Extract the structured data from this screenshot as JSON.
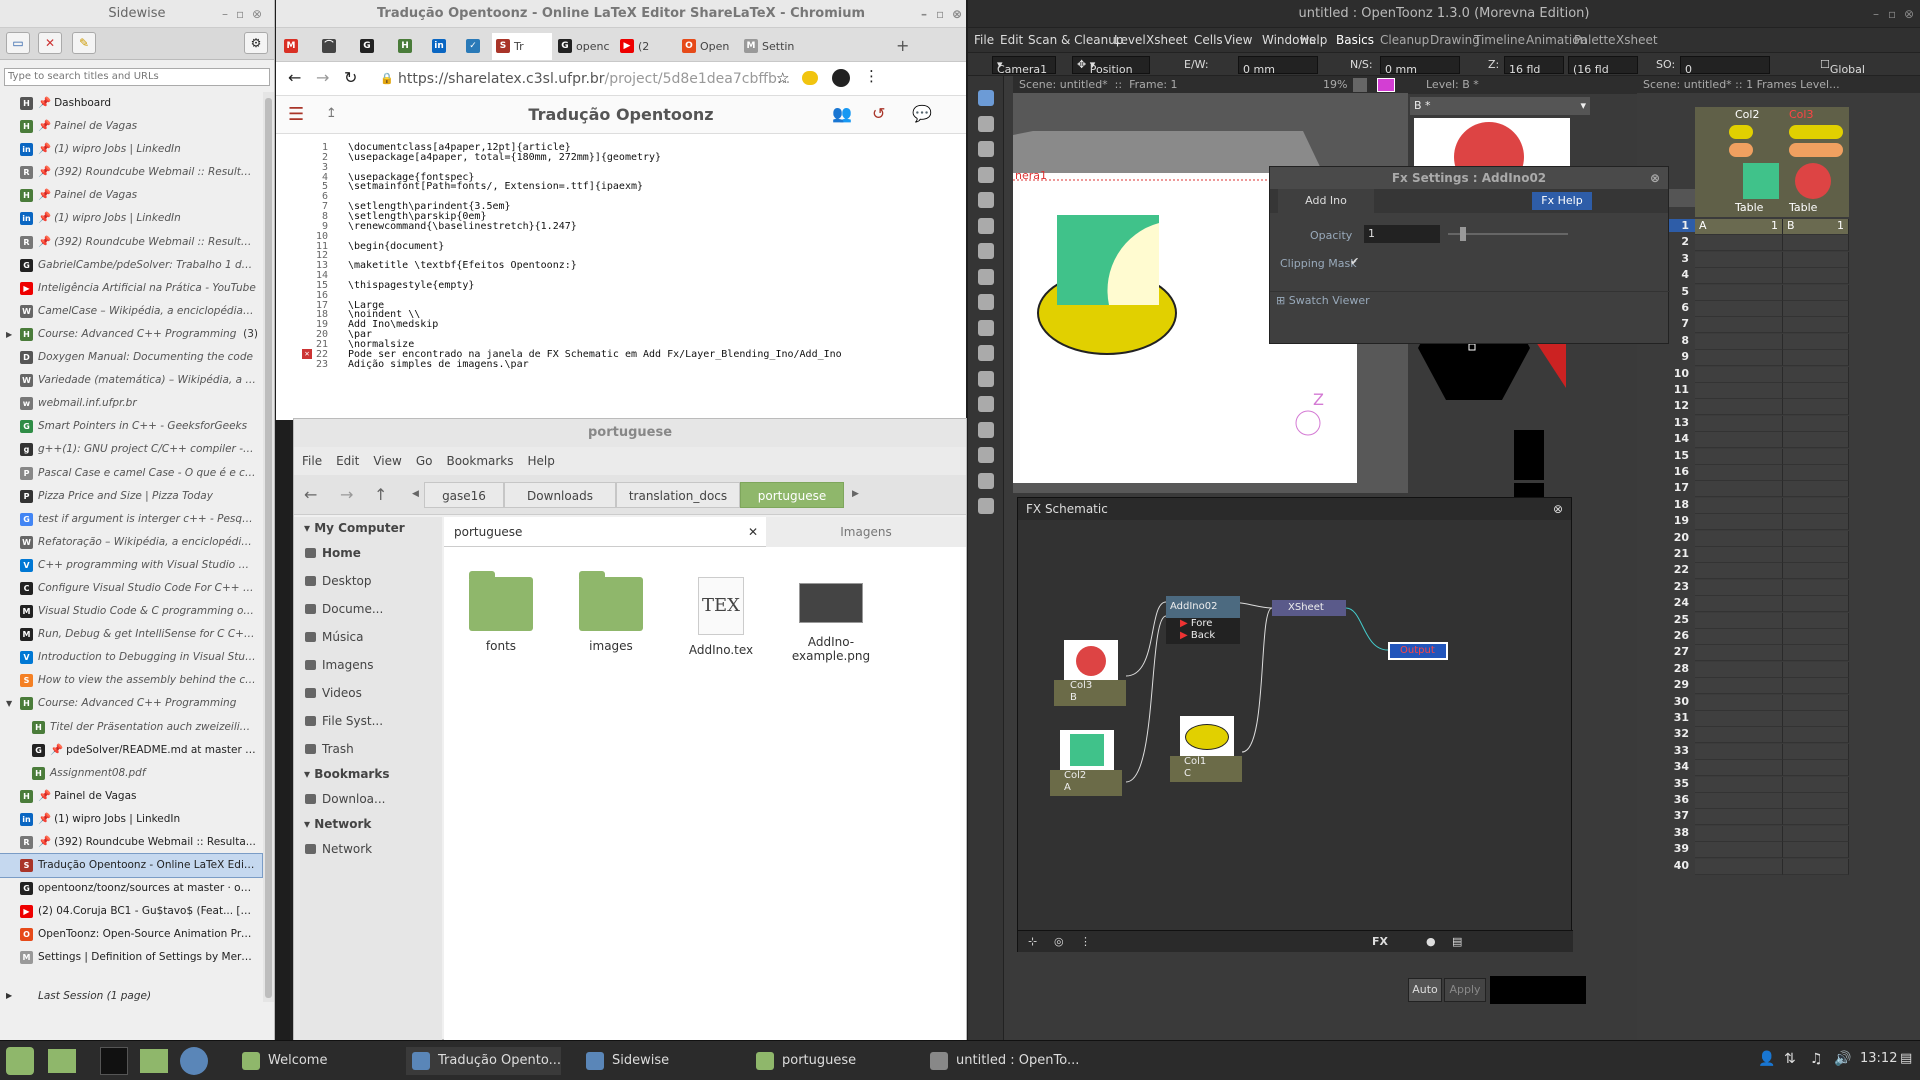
{
  "sidewise": {
    "title": "Sidewise",
    "search_placeholder": "Type to search titles and URLs",
    "items": [
      {
        "label": "Dashboard",
        "pin": true,
        "fav": "H",
        "color": "#555",
        "style": "pin"
      },
      {
        "label": "Painel de Vagas",
        "pin": true,
        "fav": "H",
        "color": "#4a7c3a",
        "style": "it"
      },
      {
        "label": "(1) wipro Jobs | LinkedIn",
        "pin": true,
        "fav": "in",
        "color": "#0a66c2",
        "style": "it"
      },
      {
        "label": "(392) Roundcube Webmail :: Resulta...",
        "pin": true,
        "fav": "R",
        "color": "#777",
        "style": "it"
      },
      {
        "label": "Painel de Vagas",
        "pin": true,
        "fav": "H",
        "color": "#4a7c3a",
        "style": "it"
      },
      {
        "label": "(1) wipro Jobs | LinkedIn",
        "pin": true,
        "fav": "in",
        "color": "#0a66c2",
        "style": "it"
      },
      {
        "label": "(392) Roundcube Webmail :: Resulta...",
        "pin": true,
        "fav": "R",
        "color": "#777",
        "style": "it"
      },
      {
        "label": "GabrielCambe/pdeSolver: Trabalho 1 da d...",
        "pin": false,
        "fav": "G",
        "color": "#222",
        "style": "it"
      },
      {
        "label": "Inteligência Artificial na Prática - YouTube",
        "pin": false,
        "fav": "▶",
        "color": "#e00",
        "style": "it"
      },
      {
        "label": "CamelCase – Wikipédia, a enciclopédia livre",
        "pin": false,
        "fav": "W",
        "color": "#666",
        "style": "it"
      },
      {
        "label": "Course: Advanced C++ Programming",
        "pin": false,
        "fav": "H",
        "color": "#4a7c3a",
        "style": "it",
        "count": "(3)",
        "arrow": "▶"
      },
      {
        "label": "Doxygen Manual: Documenting the code",
        "pin": false,
        "fav": "D",
        "color": "#555",
        "style": "it"
      },
      {
        "label": "Variedade (matemática) – Wikipédia, a en...",
        "pin": false,
        "fav": "W",
        "color": "#666",
        "style": "it"
      },
      {
        "label": "webmail.inf.ufpr.br",
        "pin": false,
        "fav": "w",
        "color": "#777",
        "style": "it"
      },
      {
        "label": "Smart Pointers in C++ - GeeksforGeeks",
        "pin": false,
        "fav": "G",
        "color": "#2f8d46",
        "style": "it"
      },
      {
        "label": "g++(1): GNU project C/C++ compiler - Lin...",
        "pin": false,
        "fav": "g",
        "color": "#333",
        "style": "it"
      },
      {
        "label": "Pascal Case e camel Case - O que é e co...",
        "pin": false,
        "fav": "P",
        "color": "#888",
        "style": "it"
      },
      {
        "label": "Pizza Price and Size | Pizza Today",
        "pin": false,
        "fav": "P",
        "color": "#333",
        "style": "it"
      },
      {
        "label": "test if argument is interger c++ - Pesquisa ...",
        "pin": false,
        "fav": "G",
        "color": "#4285f4",
        "style": "it"
      },
      {
        "label": "Refatoração – Wikipédia, a enciclopédia li...",
        "pin": false,
        "fav": "W",
        "color": "#666",
        "style": "it"
      },
      {
        "label": "C++ programming with Visual Studio Code",
        "pin": false,
        "fav": "V",
        "color": "#0078d4",
        "style": "it"
      },
      {
        "label": "Configure Visual Studio Code For C++ De...",
        "pin": false,
        "fav": "C",
        "color": "#222",
        "style": "it"
      },
      {
        "label": "Visual Studio Code & C programming on ...",
        "pin": false,
        "fav": "M",
        "color": "#222",
        "style": "it"
      },
      {
        "label": "Run, Debug & get IntelliSense for C C++ i...",
        "pin": false,
        "fav": "M",
        "color": "#222",
        "style": "it"
      },
      {
        "label": "Introduction to Debugging in Visual Studio...",
        "pin": false,
        "fav": "V",
        "color": "#0078d4",
        "style": "it"
      },
      {
        "label": "How to view the assembly behind the cod...",
        "pin": false,
        "fav": "S",
        "color": "#f48024",
        "style": "it"
      },
      {
        "label": "Course: Advanced C++ Programming",
        "pin": false,
        "fav": "H",
        "color": "#4a7c3a",
        "style": "it",
        "arrow": "▼"
      },
      {
        "label": "Titel der Präsentation auch zweizeilig U...",
        "pin": false,
        "fav": "H",
        "color": "#4a7c3a",
        "style": "it child"
      },
      {
        "label": "pdeSolver/README.md at master · ...",
        "pin": true,
        "fav": "G",
        "color": "#222",
        "style": "child"
      },
      {
        "label": "Assignment08.pdf",
        "pin": false,
        "fav": "H",
        "color": "#4a7c3a",
        "style": "it child"
      },
      {
        "label": "Painel de Vagas",
        "pin": true,
        "fav": "H",
        "color": "#4a7c3a",
        "style": "pin"
      },
      {
        "label": "(1) wipro Jobs | LinkedIn",
        "pin": true,
        "fav": "in",
        "color": "#0a66c2",
        "style": "pin"
      },
      {
        "label": "(392) Roundcube Webmail :: Resulta...",
        "pin": true,
        "fav": "R",
        "color": "#777",
        "style": "pin"
      },
      {
        "label": "Tradução Opentoonz - Online LaTeX Edito...",
        "pin": false,
        "fav": "S",
        "color": "#a93529",
        "style": "sel"
      },
      {
        "label": "opentoonz/toonz/sources at master · open...",
        "pin": false,
        "fav": "G",
        "color": "#222",
        "style": ""
      },
      {
        "label": "(2) 04.Coruja BC1 - Gu$tavo$ (Feat... [0:22]",
        "pin": false,
        "fav": "▶",
        "color": "#e00",
        "style": ""
      },
      {
        "label": "OpenToonz: Open-Source Animation Prod...",
        "pin": false,
        "fav": "O",
        "color": "#e64a19",
        "style": ""
      },
      {
        "label": "Settings | Definition of Settings by Merria...",
        "pin": false,
        "fav": "M",
        "color": "#999",
        "style": ""
      }
    ],
    "last_session": "Last Session (1 page)"
  },
  "chromium": {
    "title": "Tradução Opentoonz - Online LaTeX Editor ShareLaTeX - Chromium",
    "tabs": [
      {
        "label": "",
        "fav": "M",
        "color": "#d93025"
      },
      {
        "label": "",
        "fav": "⌒",
        "color": "#444"
      },
      {
        "label": "",
        "fav": "G",
        "color": "#222"
      },
      {
        "label": "",
        "fav": "H",
        "color": "#4a7c3a"
      },
      {
        "label": "",
        "fav": "in",
        "color": "#0a66c2"
      },
      {
        "label": "",
        "fav": "✓",
        "color": "#2a7ab8"
      },
      {
        "label": "Tr",
        "fav": "S",
        "color": "#a93529"
      },
      {
        "label": "openc",
        "fav": "G",
        "color": "#222"
      },
      {
        "label": "(2",
        "fav": "▶",
        "color": "#e00"
      },
      {
        "label": "Open",
        "fav": "O",
        "color": "#e64a19"
      },
      {
        "label": "Settin",
        "fav": "M",
        "color": "#999"
      }
    ],
    "url_host": "https://sharelatex.c3sl.ufpr.br",
    "url_path": "/project/5d8e1dea7cbffb...",
    "project_title": "Tradução Opentoonz",
    "code": [
      {
        "n": "1",
        "t": "\\documentclass[a4paper,12pt]{article}"
      },
      {
        "n": "2",
        "t": "\\usepackage[a4paper, total={180mm, 272mm}]{geometry}"
      },
      {
        "n": "3",
        "t": ""
      },
      {
        "n": "4",
        "t": "\\usepackage{fontspec}"
      },
      {
        "n": "5",
        "t": "\\setmainfont[Path=fonts/, Extension=.ttf]{ipaexm}"
      },
      {
        "n": "6",
        "t": ""
      },
      {
        "n": "7",
        "t": "\\setlength\\parindent{3.5em}"
      },
      {
        "n": "8",
        "t": "\\setlength\\parskip{0em}"
      },
      {
        "n": "9",
        "t": "\\renewcommand{\\baselinestretch}{1.247}"
      },
      {
        "n": "10",
        "t": ""
      },
      {
        "n": "11",
        "t": "\\begin{document}"
      },
      {
        "n": "12",
        "t": ""
      },
      {
        "n": "13",
        "t": "\\maketitle \\textbf{Efeitos Opentoonz:}"
      },
      {
        "n": "14",
        "t": ""
      },
      {
        "n": "15",
        "t": "\\thispagestyle{empty}"
      },
      {
        "n": "16",
        "t": ""
      },
      {
        "n": "17",
        "t": "\\Large"
      },
      {
        "n": "18",
        "t": "\\noindent \\\\"
      },
      {
        "n": "19",
        "t": "Add Ino\\medskip"
      },
      {
        "n": "20",
        "t": "\\par"
      },
      {
        "n": "21",
        "t": "\\normalsize"
      },
      {
        "n": "22",
        "t": "Pode ser encontrado na janela de FX Schematic em Add Fx/Layer_Blending_Ino/Add_Ino"
      },
      {
        "n": "23",
        "t": "Adição simples de imagens.\\par"
      }
    ]
  },
  "files": {
    "title": "portuguese",
    "menu": [
      "File",
      "Edit",
      "View",
      "Go",
      "Bookmarks",
      "Help"
    ],
    "crumbs": [
      "gase16",
      "Downloads",
      "translation_docs",
      "portuguese"
    ],
    "sidebar": {
      "my_computer": "My Computer",
      "places": [
        "Home",
        "Desktop",
        "Docume...",
        "Música",
        "Imagens",
        "Videos",
        "File Syst...",
        "Trash"
      ],
      "bookmarks": "Bookmarks",
      "bookmark_items": [
        "Downloa..."
      ],
      "network": "Network",
      "network_items": [
        "Network"
      ]
    },
    "tabs": [
      "portuguese",
      "Imagens"
    ],
    "items": [
      {
        "name": "fonts",
        "kind": "folder"
      },
      {
        "name": "images",
        "kind": "folder"
      },
      {
        "name": "AddIno.tex",
        "kind": "tex"
      },
      {
        "name": "AddIno-example.png",
        "kind": "png"
      }
    ]
  },
  "opentoonz": {
    "title": "untitled : OpenToonz 1.3.0 (Morevna Edition)",
    "menu": [
      "File",
      "Edit",
      "Scan & Cleanup",
      "Level",
      "Xsheet",
      "Cells",
      "View",
      "Windows",
      "Help",
      "Basics",
      "Cleanup",
      "Drawing",
      "Timeline",
      "Animation",
      "Palette",
      "Xsheet"
    ],
    "toolbar": {
      "camera": "Camera1",
      "position": "Position",
      "ew_label": "E/W:",
      "ew": "0 mm",
      "ns_label": "N/S:",
      "ns": "0 mm",
      "z_label": "Z:",
      "z": "16 fld",
      "z2": "(16 fld",
      "so_label": "SO:",
      "so": "0",
      "global_key": "Global Key"
    },
    "viewer": {
      "scene": "Scene: untitled*",
      "frame": "Frame: 1",
      "zoom": "19%",
      "camera_label": "nera1"
    },
    "level_strip": {
      "title": "Level:  B *",
      "level": "B *"
    },
    "xsheet_header": {
      "scene": "Scene: untitled*",
      "frames": "1 Frames",
      "level": "Level..."
    },
    "columns": [
      {
        "name": "Col2",
        "level": "Table",
        "cell": "A",
        "frame": "1"
      },
      {
        "name": "Col3",
        "level": "Table",
        "cell": "B",
        "frame": "1"
      }
    ],
    "rows": [
      "1",
      "2",
      "3",
      "4",
      "5",
      "6",
      "7",
      "8",
      "9",
      "10",
      "11",
      "12",
      "13",
      "14",
      "15",
      "16",
      "17",
      "18",
      "19",
      "20",
      "21",
      "22",
      "23",
      "24",
      "25",
      "26",
      "27",
      "28",
      "29",
      "30",
      "31",
      "32",
      "33",
      "34",
      "35",
      "36",
      "37",
      "38",
      "39",
      "40"
    ],
    "fx_settings": {
      "title": "Fx Settings : AddIno02",
      "tab": "Add Ino",
      "help": "Fx Help",
      "opacity_label": "Opacity",
      "opacity": "1",
      "clipping_label": "Clipping Mask",
      "swatch": "Swatch Viewer"
    },
    "fx_schematic": {
      "title": "FX Schematic",
      "nodes": [
        {
          "id": "col3",
          "name": "Col3",
          "sub": "B"
        },
        {
          "id": "col2",
          "name": "Col2",
          "sub": "A"
        },
        {
          "id": "col1",
          "name": "Col1",
          "sub": "C"
        },
        {
          "id": "addino",
          "name": "AddIno02",
          "port1": "Fore",
          "port2": "Back"
        },
        {
          "id": "xsheet",
          "name": "XSheet"
        },
        {
          "id": "output",
          "name": "Output"
        }
      ],
      "footer_fx": "FX"
    },
    "style_editor": {
      "auto": "Auto",
      "apply": "Apply"
    }
  },
  "taskbar": {
    "items": [
      "Welcome",
      "Tradução Opento...",
      "Sidewise",
      "portuguese",
      "untitled : OpenTo..."
    ],
    "clock": "13:12"
  }
}
